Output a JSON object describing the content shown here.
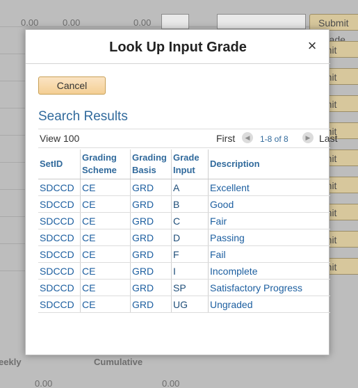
{
  "background": {
    "top_row_values": [
      "0.00",
      "0.00",
      "0.00"
    ],
    "submit_label": "Submit Grade",
    "submit_partial": "bmit",
    "bottom_labels": [
      "Weekly",
      "Cumulative"
    ],
    "bottom_values": [
      "0.00",
      "0.00"
    ]
  },
  "dialog": {
    "title": "Look Up Input Grade",
    "close_glyph": "×",
    "cancel_label": "Cancel",
    "section_title": "Search Results",
    "navigation": {
      "view_label": "View 100",
      "first_label": "First",
      "range_label": "1-8 of 8",
      "last_label": "Last"
    },
    "table": {
      "columns": [
        "SetID",
        "Grading Scheme",
        "Grading Basis",
        "Grade Input",
        "Description"
      ],
      "rows": [
        [
          "SDCCD",
          "CE",
          "GRD",
          "A",
          "Excellent"
        ],
        [
          "SDCCD",
          "CE",
          "GRD",
          "B",
          "Good"
        ],
        [
          "SDCCD",
          "CE",
          "GRD",
          "C",
          "Fair"
        ],
        [
          "SDCCD",
          "CE",
          "GRD",
          "D",
          "Passing"
        ],
        [
          "SDCCD",
          "CE",
          "GRD",
          "F",
          "Fail"
        ],
        [
          "SDCCD",
          "CE",
          "GRD",
          "I",
          "Incomplete"
        ],
        [
          "SDCCD",
          "CE",
          "GRD",
          "SP",
          "Satisfactory Progress"
        ],
        [
          "SDCCD",
          "CE",
          "GRD",
          "UG",
          "Ungraded"
        ]
      ]
    }
  }
}
